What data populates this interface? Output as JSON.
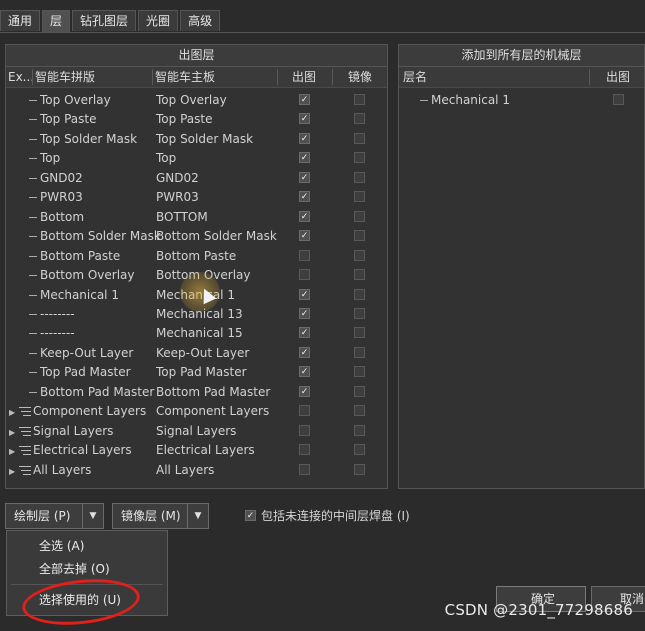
{
  "tabs": [
    "通用",
    "层",
    "钻孔图层",
    "光圈",
    "高级"
  ],
  "left_panel": {
    "title": "出图层",
    "headers": [
      "Ex...",
      "智能车拼版",
      "智能车主板",
      "出图",
      "镜像"
    ],
    "rows": [
      {
        "a": "Top Overlay",
        "b": "Top Overlay",
        "out": true,
        "mirror": false,
        "kind": "leaf"
      },
      {
        "a": "Top Paste",
        "b": "Top Paste",
        "out": true,
        "mirror": false,
        "kind": "leaf"
      },
      {
        "a": "Top Solder Mask",
        "b": "Top Solder Mask",
        "out": true,
        "mirror": false,
        "kind": "leaf"
      },
      {
        "a": "Top",
        "b": "Top",
        "out": true,
        "mirror": false,
        "kind": "leaf"
      },
      {
        "a": "GND02",
        "b": "GND02",
        "out": true,
        "mirror": false,
        "kind": "leaf"
      },
      {
        "a": "PWR03",
        "b": "PWR03",
        "out": true,
        "mirror": false,
        "kind": "leaf"
      },
      {
        "a": "Bottom",
        "b": "BOTTOM",
        "out": true,
        "mirror": false,
        "kind": "leaf"
      },
      {
        "a": "Bottom Solder Mask",
        "b": "Bottom Solder Mask",
        "out": true,
        "mirror": false,
        "kind": "leaf"
      },
      {
        "a": "Bottom Paste",
        "b": "Bottom Paste",
        "out": false,
        "mirror": false,
        "kind": "leaf"
      },
      {
        "a": "Bottom Overlay",
        "b": "Bottom Overlay",
        "out": false,
        "mirror": false,
        "kind": "leaf"
      },
      {
        "a": "Mechanical 1",
        "b": "Mechanical 1",
        "out": true,
        "mirror": false,
        "kind": "leaf"
      },
      {
        "a": "--------",
        "b": "Mechanical 13",
        "out": true,
        "mirror": false,
        "kind": "leaf"
      },
      {
        "a": "--------",
        "b": "Mechanical 15",
        "out": true,
        "mirror": false,
        "kind": "leaf"
      },
      {
        "a": "Keep-Out Layer",
        "b": "Keep-Out Layer",
        "out": true,
        "mirror": false,
        "kind": "leaf"
      },
      {
        "a": "Top Pad Master",
        "b": "Top Pad Master",
        "out": true,
        "mirror": false,
        "kind": "leaf"
      },
      {
        "a": "Bottom Pad Master",
        "b": "Bottom Pad Master",
        "out": true,
        "mirror": false,
        "kind": "leaf"
      },
      {
        "a": "Component Layers",
        "b": "Component Layers",
        "out": false,
        "mirror": false,
        "kind": "group"
      },
      {
        "a": "Signal Layers",
        "b": "Signal Layers",
        "out": false,
        "mirror": false,
        "kind": "group"
      },
      {
        "a": "Electrical Layers",
        "b": "Electrical Layers",
        "out": false,
        "mirror": false,
        "kind": "group"
      },
      {
        "a": "All Layers",
        "b": "All Layers",
        "out": false,
        "mirror": false,
        "kind": "group"
      }
    ]
  },
  "right_panel": {
    "title": "添加到所有层的机械层",
    "headers": [
      "层名",
      "出图"
    ],
    "rows": [
      {
        "name": "Mechanical 1",
        "out": false
      }
    ]
  },
  "buttons": {
    "plot_layers": "绘制层 (P)",
    "mirror_layers": "镜像层 (M)",
    "include_unconnected": "包括未连接的中间层焊盘 (I)",
    "ok": "确定",
    "cancel": "取消"
  },
  "menu": [
    "全选 (A)",
    "全部去掉 (O)",
    "选择使用的 (U)"
  ],
  "watermark": "CSDN @2301_77298686",
  "colors": {
    "annotation": "#e0201a",
    "background": "#2b2b2b"
  }
}
